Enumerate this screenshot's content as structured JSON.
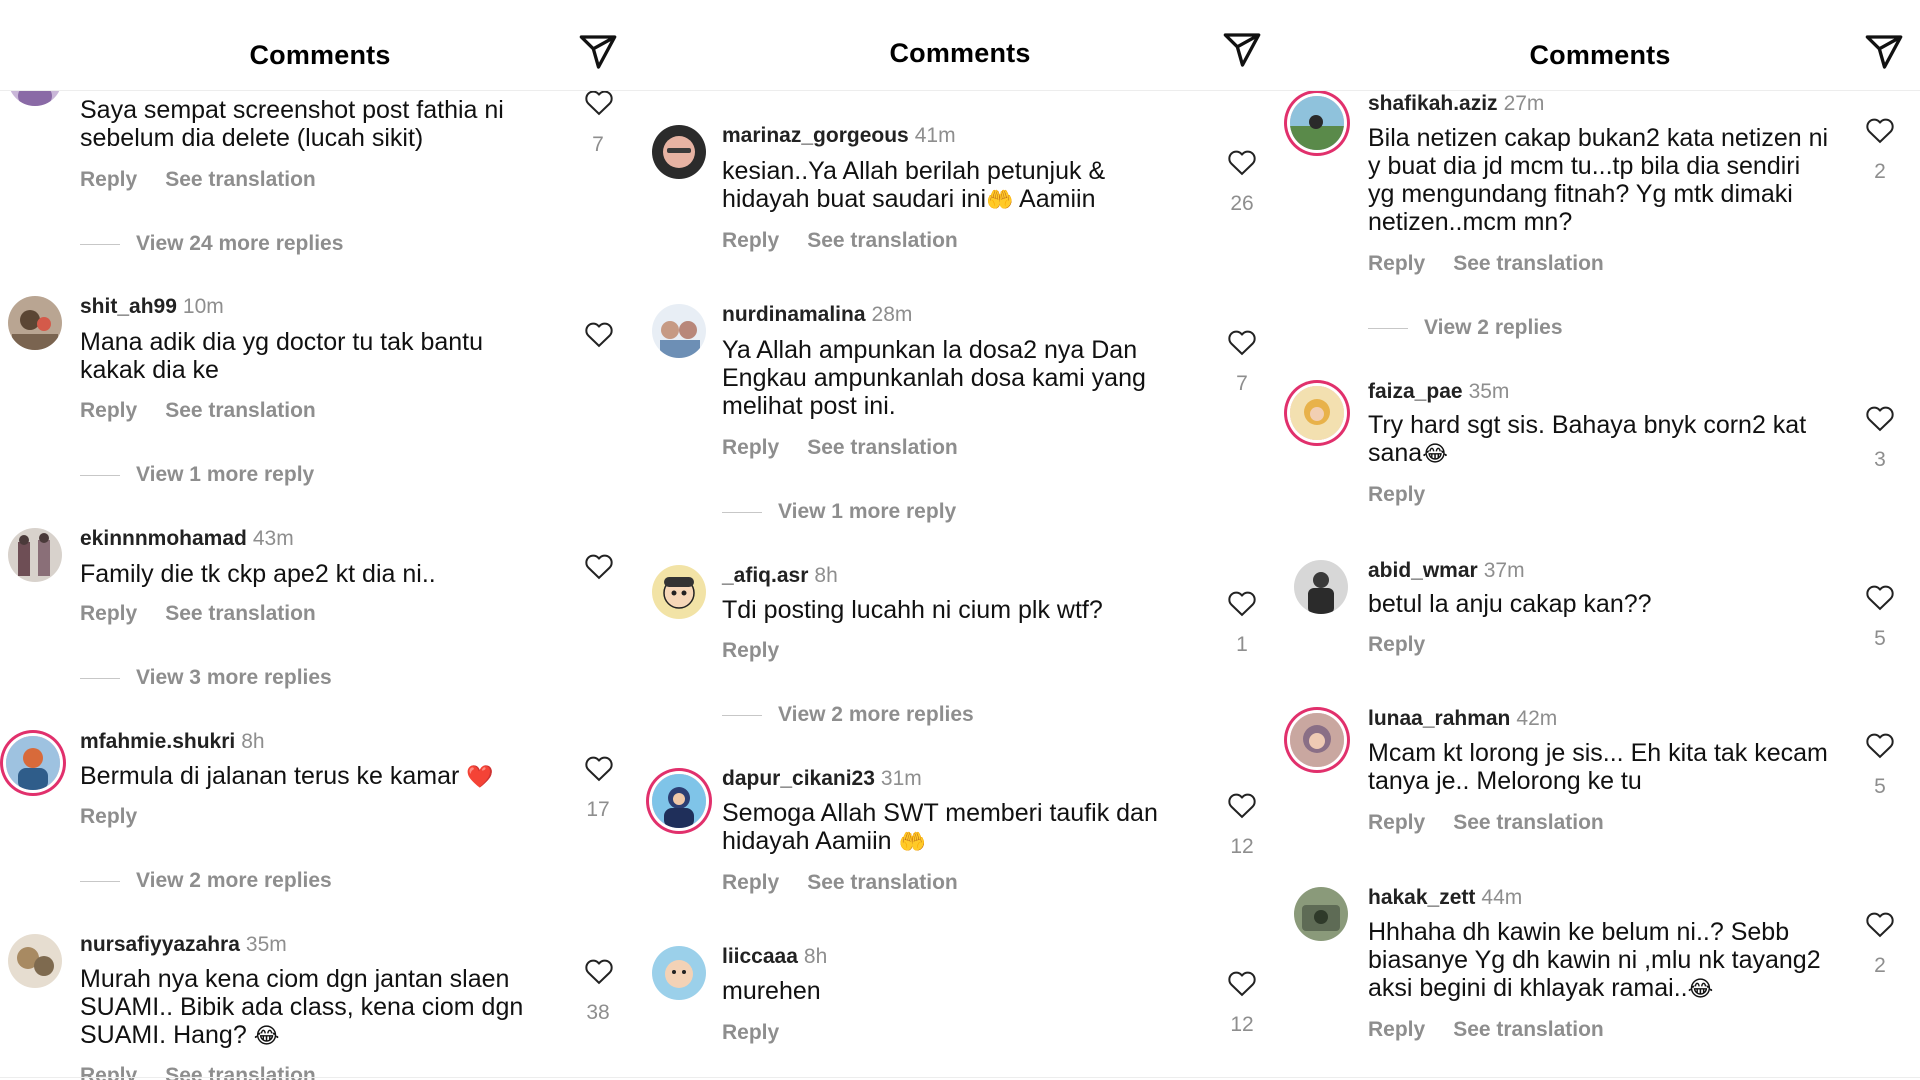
{
  "panels": [
    {
      "title": "Comments",
      "comments": [
        {
          "text": "Saya sempat screenshot post fathia ni\nsebelum dia delete (lucah sikit)",
          "reply": "Reply",
          "translation": "See translation",
          "likes": "7",
          "view_replies": "View 24 more replies"
        },
        {
          "username": "shit_ah99",
          "time": "10m",
          "text": "Mana adik dia yg doctor tu tak bantu\nkakak dia ke",
          "reply": "Reply",
          "translation": "See translation",
          "view_replies": "View 1 more reply"
        },
        {
          "username": "ekinnnmohamad",
          "time": "43m",
          "text": "Family die tk ckp ape2 kt dia ni..",
          "reply": "Reply",
          "translation": "See translation",
          "view_replies": "View 3 more replies"
        },
        {
          "username": "mfahmie.shukri",
          "time": "8h",
          "text": "Bermula di jalanan terus ke kamar ",
          "emoji": "❤️",
          "reply": "Reply",
          "likes": "17",
          "view_replies": "View 2 more replies"
        },
        {
          "username": "nursafiyyazahra",
          "time": "35m",
          "text": "Murah nya kena ciom dgn jantan slaen\nSUAMI.. Bibik ada class, kena ciom dgn\nSUAMI. Hang? ",
          "emoji": "😂",
          "reply": "Reply",
          "translation": "See translation",
          "likes": "38"
        }
      ]
    },
    {
      "title": "Comments",
      "comments": [
        {
          "username": "marinaz_gorgeous",
          "time": "41m",
          "text": "kesian..Ya Allah berilah petunjuk &\nhidayah buat saudari ini",
          "emoji": "🤲",
          "text_after": " Aamiin",
          "reply": "Reply",
          "translation": "See translation",
          "likes": "26"
        },
        {
          "username": "nurdinamalina",
          "time": "28m",
          "text": "Ya Allah ampunkan la dosa2 nya Dan\nEngkau ampunkanlah dosa  kami yang\nmelihat post ini.",
          "reply": "Reply",
          "translation": "See translation",
          "likes": "7",
          "view_replies": "View 1 more reply"
        },
        {
          "username": "_afiq.asr",
          "time": "8h",
          "text": "Tdi posting lucahh ni cium plk wtf?",
          "reply": "Reply",
          "likes": "1",
          "view_replies": "View 2 more replies"
        },
        {
          "username": "dapur_cikani23",
          "time": "31m",
          "text": "Semoga Allah SWT memberi taufik dan\nhidayah Aamiin ",
          "emoji": "🤲",
          "reply": "Reply",
          "translation": "See translation",
          "likes": "12"
        },
        {
          "username": "liiccaaa",
          "time": "8h",
          "text": "murehen",
          "reply": "Reply",
          "likes": "12"
        }
      ]
    },
    {
      "title": "Comments",
      "comments": [
        {
          "username": "shafikah.aziz",
          "time": "27m",
          "text": "Bila netizen cakap bukan2 kata netizen ni\ny buat dia jd mcm tu...tp bila dia sendiri\nyg mengundang fitnah? Yg mtk dimaki\nnetizen..mcm mn?",
          "reply": "Reply",
          "translation": "See translation",
          "likes": "2",
          "view_replies": "View 2 replies"
        },
        {
          "username": "faiza_pae",
          "time": "35m",
          "text": "Try hard sgt sis. Bahaya bnyk corn2 kat\nsana",
          "emoji": "😂",
          "reply": "Reply",
          "likes": "3"
        },
        {
          "username": "abid_wmar",
          "time": "37m",
          "text": "betul la anju cakap kan??",
          "reply": "Reply",
          "likes": "5"
        },
        {
          "username": "lunaa_rahman",
          "time": "42m",
          "text": "Mcam kt lorong je sis... Eh kita tak kecam\ntanya je.. Melorong ke tu",
          "reply": "Reply",
          "translation": "See translation",
          "likes": "5"
        },
        {
          "username": "hakak_zett",
          "time": "44m",
          "text": "Hhhaha dh kawin ke belum ni..? Sebb\nbiasanye Yg dh kawin ni ,mlu nk tayang2\naksi begini di khlayak ramai..",
          "emoji": "😂",
          "reply": "Reply",
          "translation": "See translation",
          "likes": "2"
        }
      ]
    }
  ],
  "icons": {
    "send": "send-icon",
    "like": "heart-outline-icon"
  },
  "colors": {
    "muted_text": "#8e8e8e",
    "story_ring": "#e1306c",
    "heart_emoji": "#e0242b"
  }
}
